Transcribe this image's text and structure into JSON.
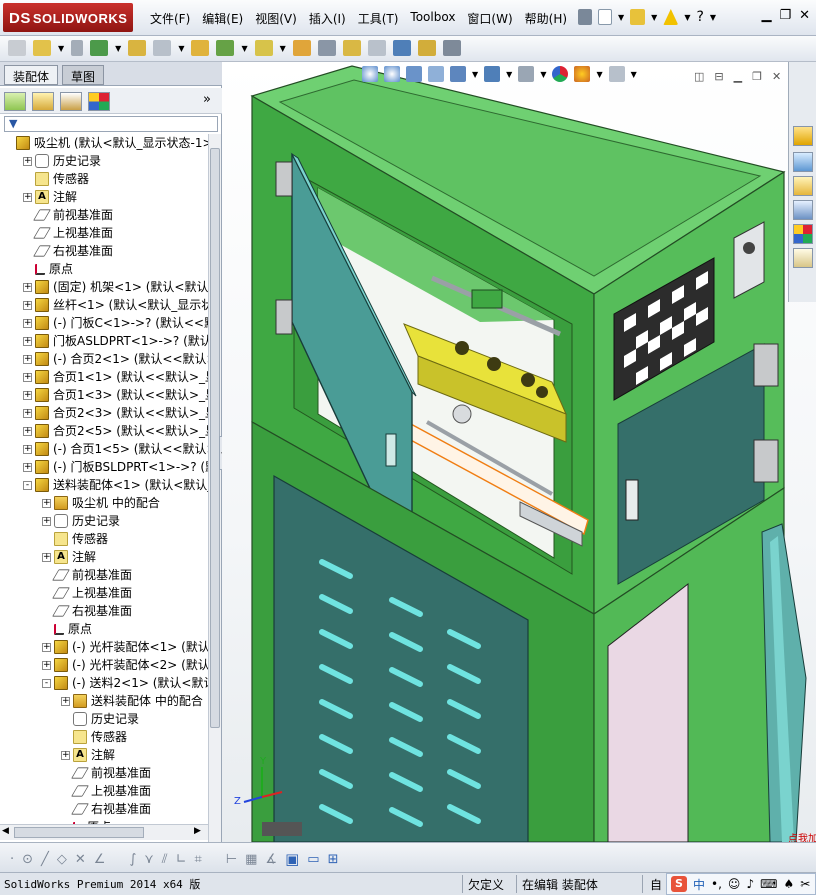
{
  "app": {
    "logo_ds": "DS",
    "logo_text": "SOLIDWORKS",
    "menus": [
      "文件(F)",
      "编辑(E)",
      "视图(V)",
      "插入(I)",
      "工具(T)",
      "Toolbox",
      "窗口(W)",
      "帮助(H)"
    ]
  },
  "left_panel": {
    "tabs": [
      "装配体",
      "草图"
    ],
    "tree": [
      {
        "label": "吸尘机  (默认<默认_显示状态-1>",
        "icon": "assembly-icon",
        "indent": 0,
        "expand": ""
      },
      {
        "label": "历史记录",
        "icon": "history-icon",
        "indent": 1,
        "expand": "+"
      },
      {
        "label": "传感器",
        "icon": "sensor-icon",
        "indent": 1,
        "expand": ""
      },
      {
        "label": "注解",
        "icon": "annotation-icon",
        "indent": 1,
        "expand": "+"
      },
      {
        "label": "前视基准面",
        "icon": "plane-icon",
        "indent": 1,
        "expand": ""
      },
      {
        "label": "上视基准面",
        "icon": "plane-icon",
        "indent": 1,
        "expand": ""
      },
      {
        "label": "右视基准面",
        "icon": "plane-icon",
        "indent": 1,
        "expand": ""
      },
      {
        "label": "原点",
        "icon": "origin-icon",
        "indent": 1,
        "expand": ""
      },
      {
        "label": "(固定) 机架<1> (默认<默认_显",
        "icon": "part-icon",
        "indent": 1,
        "expand": "+"
      },
      {
        "label": "丝杆<1> (默认<默认_显示状态",
        "icon": "part-icon",
        "indent": 1,
        "expand": "+"
      },
      {
        "label": "(-) 门板C<1>->? (默认<<默认",
        "icon": "part-icon",
        "indent": 1,
        "expand": "+"
      },
      {
        "label": "门板ASLDPRT<1>->? (默认<<默",
        "icon": "part-icon",
        "indent": 1,
        "expand": "+"
      },
      {
        "label": "(-) 合页2<1> (默认<<默认>_显",
        "icon": "part-icon",
        "indent": 1,
        "expand": "+"
      },
      {
        "label": "合页1<1> (默认<<默认>_显示状",
        "icon": "part-icon",
        "indent": 1,
        "expand": "+"
      },
      {
        "label": "合页1<3> (默认<<默认>_显示状",
        "icon": "part-icon",
        "indent": 1,
        "expand": "+"
      },
      {
        "label": "合页2<3> (默认<<默认>_显示状",
        "icon": "part-icon",
        "indent": 1,
        "expand": "+"
      },
      {
        "label": "合页2<5> (默认<<默认>_显示状",
        "icon": "part-icon",
        "indent": 1,
        "expand": "+"
      },
      {
        "label": "(-) 合页1<5> (默认<<默认>_显",
        "icon": "part-icon",
        "indent": 1,
        "expand": "+"
      },
      {
        "label": "(-) 门板BSLDPRT<1>->? (默认",
        "icon": "part-icon",
        "indent": 1,
        "expand": "+"
      },
      {
        "label": "送料装配体<1> (默认<默认_显",
        "icon": "assembly-icon",
        "indent": 1,
        "expand": "-"
      },
      {
        "label": "吸尘机 中的配合",
        "icon": "mates-icon",
        "indent": 2,
        "expand": "+"
      },
      {
        "label": "历史记录",
        "icon": "history-icon",
        "indent": 2,
        "expand": "+"
      },
      {
        "label": "传感器",
        "icon": "sensor-icon",
        "indent": 2,
        "expand": ""
      },
      {
        "label": "注解",
        "icon": "annotation-icon",
        "indent": 2,
        "expand": "+"
      },
      {
        "label": "前视基准面",
        "icon": "plane-icon",
        "indent": 2,
        "expand": ""
      },
      {
        "label": "上视基准面",
        "icon": "plane-icon",
        "indent": 2,
        "expand": ""
      },
      {
        "label": "右视基准面",
        "icon": "plane-icon",
        "indent": 2,
        "expand": ""
      },
      {
        "label": "原点",
        "icon": "origin-icon",
        "indent": 2,
        "expand": ""
      },
      {
        "label": "(-) 光杆装配体<1> (默认<",
        "icon": "assembly-icon",
        "indent": 2,
        "expand": "+"
      },
      {
        "label": "(-) 光杆装配体<2> (默认<",
        "icon": "assembly-icon",
        "indent": 2,
        "expand": "+"
      },
      {
        "label": "(-) 送料2<1> (默认<默认_",
        "icon": "assembly-icon",
        "indent": 2,
        "expand": "-"
      },
      {
        "label": "送料装配体 中的配合",
        "icon": "mates-icon",
        "indent": 3,
        "expand": "+"
      },
      {
        "label": "历史记录",
        "icon": "history-icon",
        "indent": 3,
        "expand": ""
      },
      {
        "label": "传感器",
        "icon": "sensor-icon",
        "indent": 3,
        "expand": ""
      },
      {
        "label": "注解",
        "icon": "annotation-icon",
        "indent": 3,
        "expand": "+"
      },
      {
        "label": "前视基准面",
        "icon": "plane-icon",
        "indent": 3,
        "expand": ""
      },
      {
        "label": "上视基准面",
        "icon": "plane-icon",
        "indent": 3,
        "expand": ""
      },
      {
        "label": "右视基准面",
        "icon": "plane-icon",
        "indent": 3,
        "expand": ""
      },
      {
        "label": "原点",
        "icon": "origin-icon",
        "indent": 3,
        "expand": ""
      }
    ]
  },
  "viewport": {
    "triad": {
      "x_label": "Y",
      "z_label": "Z"
    },
    "badge_text": "点我加"
  },
  "status": {
    "app_version": "SolidWorks Premium 2014 x64 版",
    "definition": "欠定义",
    "editing": "在编辑 装配体",
    "ime_partial": "自",
    "ime_lang": "中"
  },
  "colors": {
    "frame_green": "#5fc262",
    "frame_dark": "#2f8a32",
    "door_teal": "#3f8f8a",
    "panel_teal": "#356f6a",
    "slot_cyan": "#6fe3e0",
    "carriage_yellow": "#e8e23a"
  }
}
